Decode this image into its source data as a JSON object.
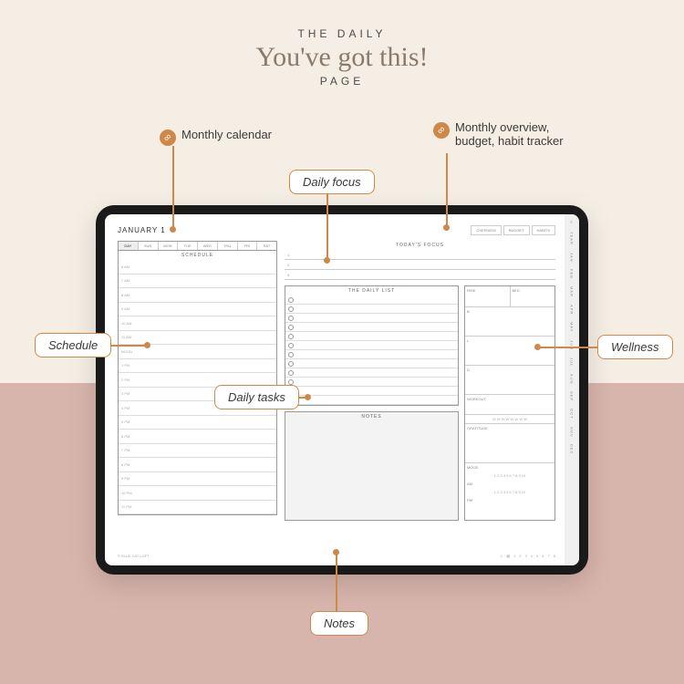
{
  "header": {
    "line1": "THE DAILY",
    "line2": "You've got this!",
    "line3": "PAGE"
  },
  "callouts": {
    "monthly_cal": "Monthly calendar",
    "monthly_ov": "Monthly overview,\nbudget, habit tracker"
  },
  "tags": {
    "focus": "Daily focus",
    "schedule": "Schedule",
    "tasks": "Daily tasks",
    "wellness": "Wellness",
    "notes": "Notes"
  },
  "planner": {
    "date": "JANUARY 1",
    "top_tabs": [
      "OVERVIEW",
      "BUDGET",
      "HABITS"
    ],
    "days": [
      "DAY",
      "SUN",
      "MON",
      "TUE",
      "WED",
      "THU",
      "FRI",
      "SAT"
    ],
    "schedule_title": "SCHEDULE",
    "hours": [
      "6 AM",
      "7 AM",
      "8 AM",
      "9 AM",
      "10 AM",
      "11 AM",
      "NOON",
      "1 PM",
      "2 PM",
      "3 PM",
      "4 PM",
      "5 PM",
      "6 PM",
      "7 PM",
      "8 PM",
      "9 PM",
      "10 PM",
      "11 PM"
    ],
    "focus_title": "TODAY'S FOCUS",
    "focus_nums": [
      "1.",
      "2.",
      "3."
    ],
    "list_title": "THE DAILY LIST",
    "notes_title": "NOTES",
    "wellness": {
      "rise": "RISE",
      "bed": "BED",
      "b": "B",
      "l": "L",
      "d": "D",
      "workout": "WORKOUT",
      "water": "W  W  W  W  W  W  W  W",
      "gratitude": "GRATITUDE",
      "mood": "MOOD",
      "mood_scale": "1  2  3  4  5  6  7  8  9  10",
      "am": "AM",
      "pm": "PM"
    },
    "sidebar": [
      "≡",
      "YEAR",
      "JAN",
      "FEB",
      "MAR",
      "APR",
      "MAY",
      "JUN",
      "JUL",
      "AUG",
      "SEP",
      "OCT",
      "NOV",
      "DEC"
    ],
    "footer_left": "© BLUE CAT LOFT",
    "pages": [
      "1",
      "2",
      "3",
      "4",
      "5",
      "6",
      "7",
      "8"
    ]
  }
}
